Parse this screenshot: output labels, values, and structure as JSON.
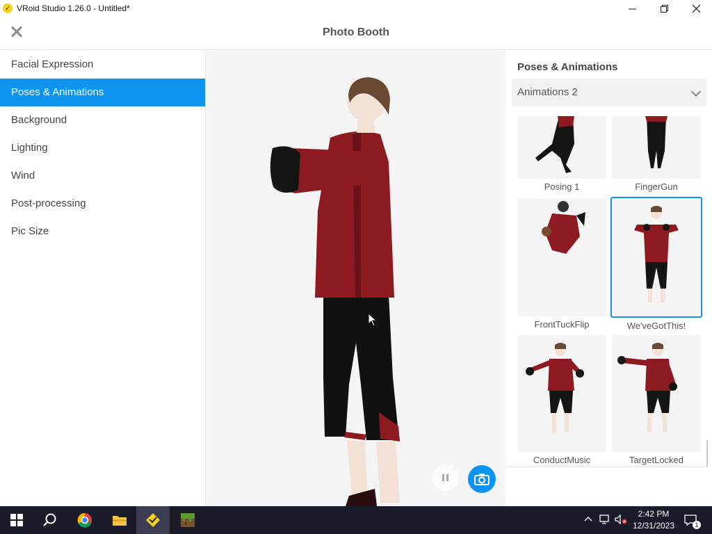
{
  "window": {
    "title": "VRoid Studio 1.26.0 - Untitled*"
  },
  "header": {
    "title": "Photo Booth"
  },
  "sidebar": {
    "items": [
      {
        "label": "Facial Expression",
        "active": false
      },
      {
        "label": "Poses & Animations",
        "active": true
      },
      {
        "label": "Background",
        "active": false
      },
      {
        "label": "Lighting",
        "active": false
      },
      {
        "label": "Wind",
        "active": false
      },
      {
        "label": "Post-processing",
        "active": false
      },
      {
        "label": "Pic Size",
        "active": false
      }
    ]
  },
  "panel": {
    "title": "Poses & Animations",
    "dropdown_value": "Animations 2",
    "cards": [
      {
        "label": "Posing 1"
      },
      {
        "label": "FingerGun"
      },
      {
        "label": "FrontTuckFlip"
      },
      {
        "label": "We'veGotThis!",
        "selected": true
      },
      {
        "label": "ConductMusic"
      },
      {
        "label": "TargetLocked"
      }
    ]
  },
  "taskbar": {
    "time": "2:42 PM",
    "date": "12/31/2023",
    "notifications": "1"
  },
  "colors": {
    "accent": "#0d94f0",
    "taskbar": "#1b1c2a",
    "jacket": "#8e1a22"
  }
}
